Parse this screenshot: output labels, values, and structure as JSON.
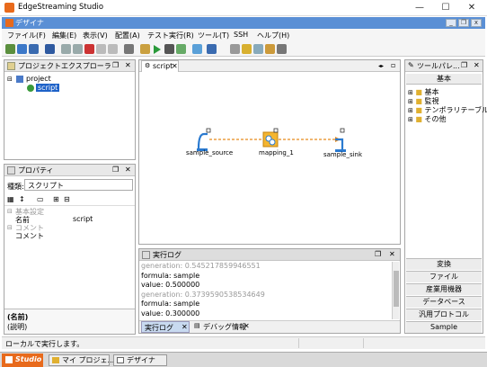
{
  "app": {
    "title": "EdgeStreaming Studio"
  },
  "doc": {
    "title": "デザイナ"
  },
  "menu": [
    "ファイル(F)",
    "編集(E)",
    "表示(V)",
    "配置(A)",
    "テスト実行(R)",
    "ツール(T)",
    "SSH",
    "ヘルプ(H)"
  ],
  "explorer": {
    "title": "プロジェクトエクスプローラ",
    "project": "project",
    "script": "script"
  },
  "editor": {
    "tab": "script",
    "nodes": {
      "source": "sample_source",
      "mapping": "mapping_1",
      "sink": "sample_sink"
    }
  },
  "properties": {
    "title": "プロパティ",
    "kind_label": "種類:",
    "kind_value": "スクリプト",
    "cat_basic": "基本設定",
    "name_key": "名前",
    "name_value": "script",
    "cat_comment": "コメント",
    "comment_key": "コメント",
    "desc_title": "(名前)",
    "desc_text": "(説明)"
  },
  "log": {
    "title": "実行ログ",
    "lines": [
      "generation: 0.545217859946551",
      "formula: sample",
      "value: 0.500000",
      "generation: 0.3739590538534649",
      "formula: sample",
      "value: 0.300000"
    ],
    "tab_log": "実行ログ",
    "tab_debug": "デバッグ情報"
  },
  "palette": {
    "title": "ツールパレ...",
    "header": "基本",
    "tree": [
      "基本",
      "監視",
      "テンポラリテーブル",
      "その他"
    ],
    "buttons": [
      "変換",
      "ファイル",
      "産業用機器",
      "データベース",
      "汎用プロトコル",
      "Sample"
    ]
  },
  "status": {
    "text": "ローカルで実行します。"
  },
  "taskbar": {
    "studio": "Studio",
    "task1": "マイ プロジェ...",
    "task2": "デザイナ"
  },
  "colors": {
    "accent": "#e86a1c",
    "docbar": "#5a8fd5"
  }
}
